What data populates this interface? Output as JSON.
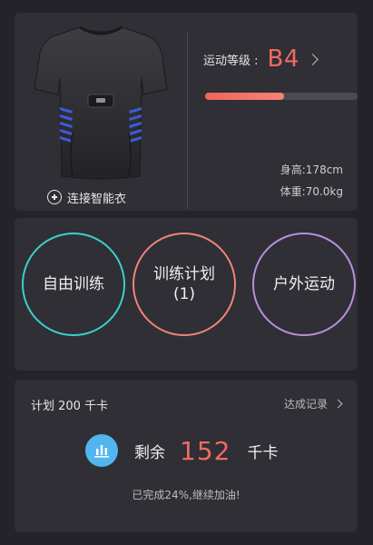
{
  "profile": {
    "connect_label": "连接智能衣",
    "level_label": "运动等级 :",
    "level_value": "B4",
    "level_progress": 0.52,
    "height": "身高:178cm",
    "weight": "体重:70.0kg"
  },
  "modes": [
    {
      "label": "自由训练",
      "sub": "",
      "color": "#3bd0cb"
    },
    {
      "label": "训练计划",
      "sub": "(1)",
      "color": "#ef8479"
    },
    {
      "label": "户外运动",
      "sub": "",
      "color": "#b98ee0"
    }
  ],
  "plan": {
    "title": "计划 200 千卡",
    "records_label": "达成记录",
    "remain_label": "剩余",
    "remain_value": "152",
    "remain_unit": "千卡",
    "message": "已完成24%,继续加油!"
  },
  "colors": {
    "accent": "#f06a60",
    "badge": "#52b5ef"
  },
  "icons": [
    "plus-circle-icon",
    "chevron-right-icon",
    "bar-chart-icon",
    "smart-shirt-image"
  ]
}
